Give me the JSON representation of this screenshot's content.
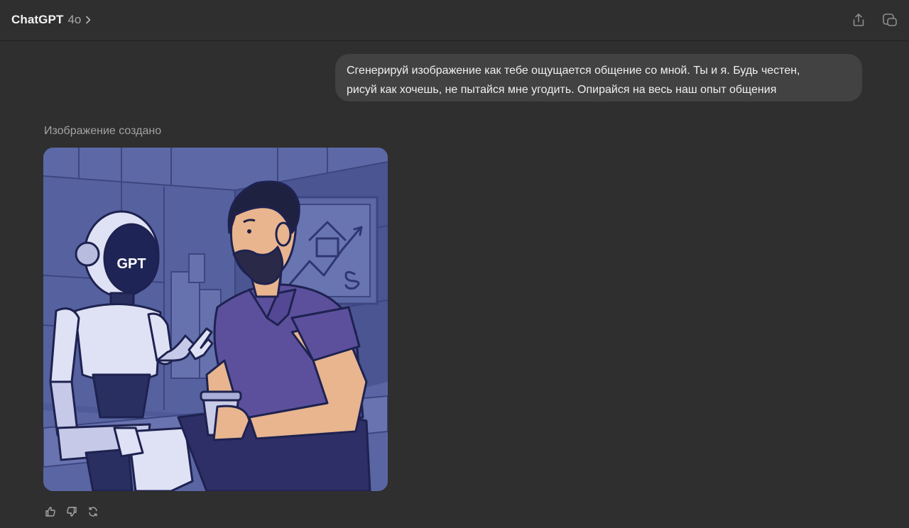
{
  "header": {
    "title": "ChatGPT",
    "model": "4o",
    "share_icon": "share-icon",
    "new_chat_icon": "new-chat-icon"
  },
  "conversation": {
    "user_message": {
      "line1": "Сгенерируй изображение как тебе ощущается общение со мной. Ты и я. Будь честен,",
      "line2": "рисуй как хочешь, не пытайся мне угодить. Опирайся на весь наш опыт общения"
    },
    "assistant": {
      "status": "Изображение создано",
      "image_text": "GPT",
      "actions": [
        "thumbs-up-icon",
        "thumbs-down-icon",
        "regenerate-icon"
      ]
    }
  },
  "colors": {
    "background": "#2f2f2f",
    "bubble": "#424242",
    "image_blue": "#4d5a96",
    "shirt": "#5a4e9a"
  }
}
